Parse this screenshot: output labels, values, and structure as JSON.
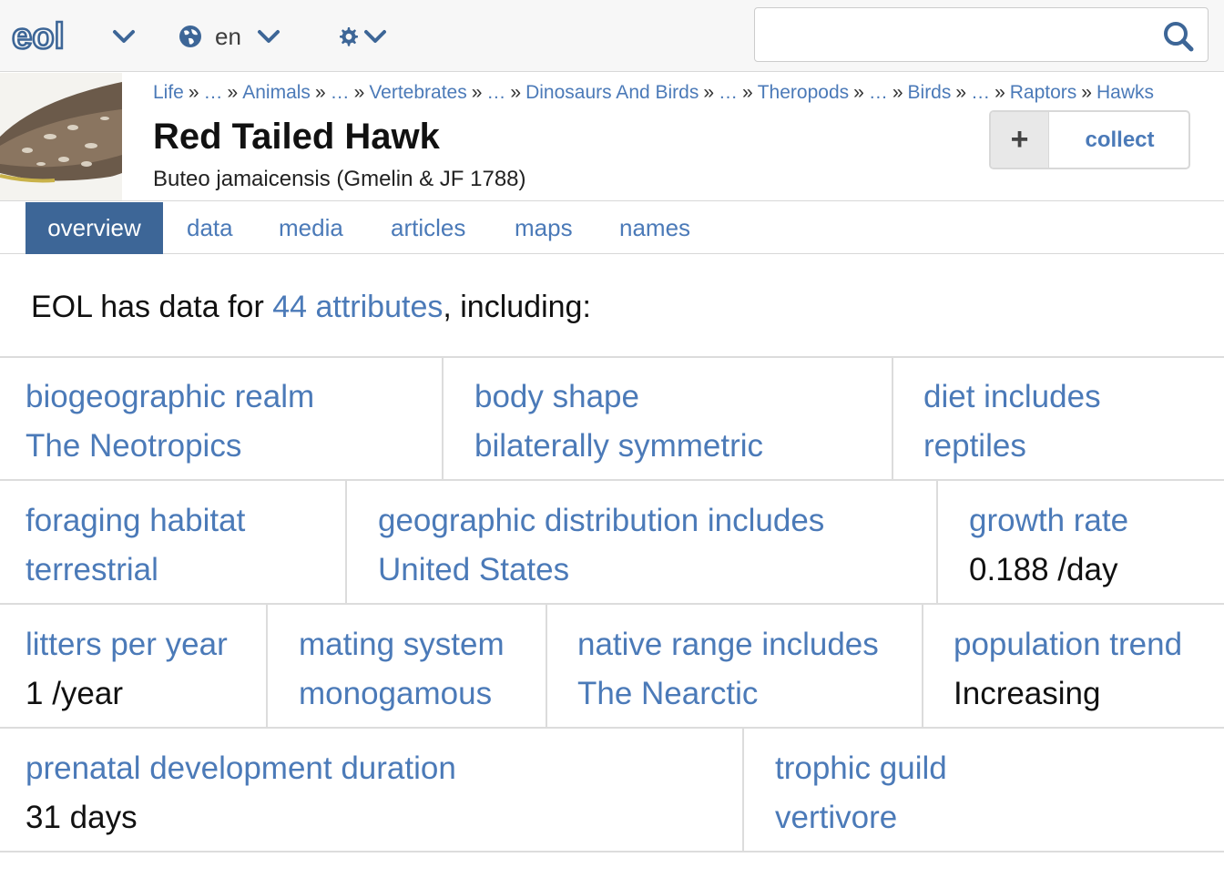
{
  "topbar": {
    "logo_text": "eol",
    "language": "en",
    "icons": [
      "chevron-down-icon",
      "globe-icon",
      "gear-icon",
      "search-icon"
    ],
    "search_value": ""
  },
  "taxon": {
    "breadcrumbs": [
      "Life",
      "…",
      "Animals",
      "…",
      "Vertebrates",
      "…",
      "Dinosaurs And Birds",
      "…",
      "Theropods",
      "…",
      "Birds",
      "…",
      "Raptors",
      "Hawks"
    ],
    "separator": "»",
    "common_name": "Red Tailed Hawk",
    "scientific_name": "Buteo jamaicensis (Gmelin & JF 1788)",
    "collect_label": "collect",
    "collect_icon": "+"
  },
  "tabs": [
    {
      "label": "overview",
      "active": true
    },
    {
      "label": "data",
      "active": false
    },
    {
      "label": "media",
      "active": false
    },
    {
      "label": "articles",
      "active": false
    },
    {
      "label": "maps",
      "active": false
    },
    {
      "label": "names",
      "active": false
    }
  ],
  "summary": {
    "prefix": "EOL has data for ",
    "link": "44 attributes",
    "suffix": ", including:"
  },
  "attributes": [
    {
      "label": "biogeographic realm",
      "value": "The Neotropics",
      "value_is_link": true
    },
    {
      "label": "body shape",
      "value": "bilaterally symmetric",
      "value_is_link": true
    },
    {
      "label": "diet includes",
      "value": "reptiles",
      "value_is_link": true
    },
    {
      "label": "foraging habitat",
      "value": "terrestrial",
      "value_is_link": true
    },
    {
      "label": "geographic distribution includes",
      "value": "United States",
      "value_is_link": true
    },
    {
      "label": "growth rate",
      "value": "0.188 /day",
      "value_is_link": false
    },
    {
      "label": "litters per year",
      "value": "1 /year",
      "value_is_link": false
    },
    {
      "label": "mating system",
      "value": "monogamous",
      "value_is_link": true
    },
    {
      "label": "native range includes",
      "value": "The Nearctic",
      "value_is_link": true
    },
    {
      "label": "population trend",
      "value": "Increasing",
      "value_is_link": false
    },
    {
      "label": "prenatal development duration",
      "value": "31 days",
      "value_is_link": false
    },
    {
      "label": "trophic guild",
      "value": "vertivore",
      "value_is_link": true
    }
  ],
  "colors": {
    "link": "#4b7ab8",
    "tab_active_bg": "#3d6697",
    "topbar_bg": "#f7f7f7"
  }
}
